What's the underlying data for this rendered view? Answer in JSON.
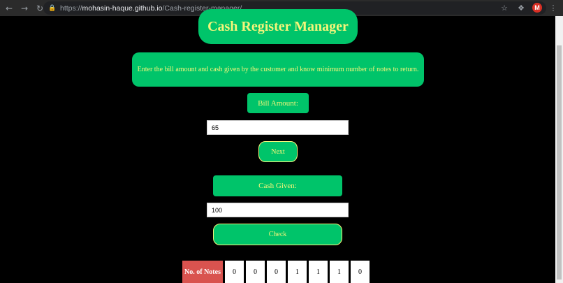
{
  "browser": {
    "url_host": "mohasin-haque.github.io",
    "url_path": "/Cash-register-manager/",
    "url_scheme": "https://",
    "profile_initial": "M",
    "icons": {
      "back": "back-arrow-icon",
      "forward": "forward-arrow-icon",
      "reload": "reload-icon",
      "lock": "lock-icon",
      "star": "star-icon",
      "extensions": "puzzle-icon",
      "menu": "kebab-menu-icon"
    }
  },
  "page": {
    "title": "Cash Register Manager",
    "description": "Enter the bill amount and cash given by the customer and know minimum number of notes to return.",
    "bill_label": "Bill Amount:",
    "bill_value": "65",
    "next_label": "Next",
    "cash_label": "Cash Given:",
    "cash_value": "100",
    "check_label": "Check",
    "notes_header": "No. of Notes",
    "notes": [
      "0",
      "0",
      "0",
      "1",
      "1",
      "1",
      "0"
    ]
  },
  "colors": {
    "background": "#000000",
    "accent_green": "#00c46a",
    "text_yellow": "#f3f57a",
    "notes_header_red": "#d9534f"
  }
}
